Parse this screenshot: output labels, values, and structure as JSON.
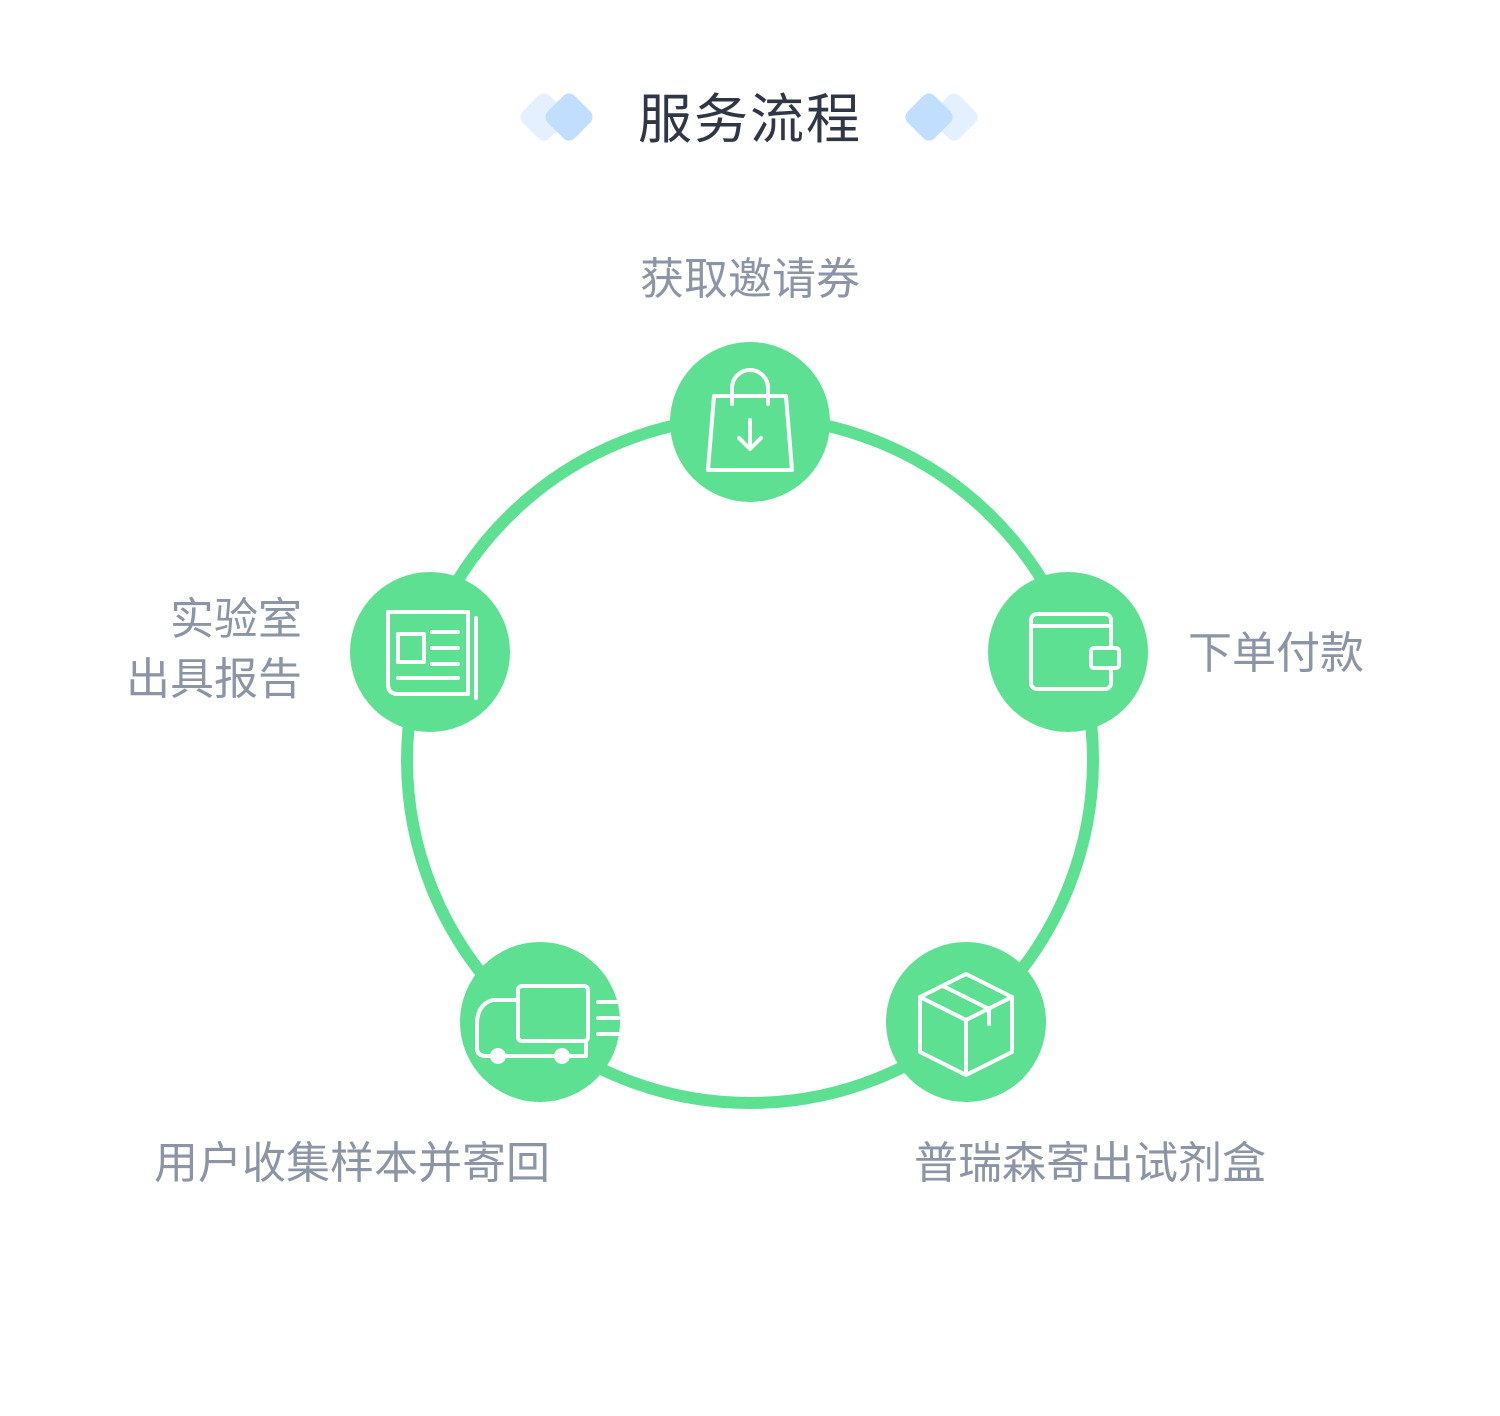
{
  "header": {
    "title": "服务流程"
  },
  "colors": {
    "accent_green": "#5ee093",
    "title_text": "#2f3746",
    "label_text": "#8b95a5",
    "decor_blue_dark": "#c2deff",
    "decor_blue_light": "#e4efff"
  },
  "steps": [
    {
      "label": "获取邀请券",
      "icon": "shopping-bag-download-icon"
    },
    {
      "label": "下单付款",
      "icon": "wallet-icon"
    },
    {
      "label": "普瑞森寄出试剂盒",
      "icon": "package-box-icon"
    },
    {
      "label": "用户收集样本并寄回",
      "icon": "delivery-truck-icon"
    },
    {
      "label_lines": [
        "实验室",
        "出具报告"
      ],
      "icon": "report-document-icon"
    }
  ]
}
